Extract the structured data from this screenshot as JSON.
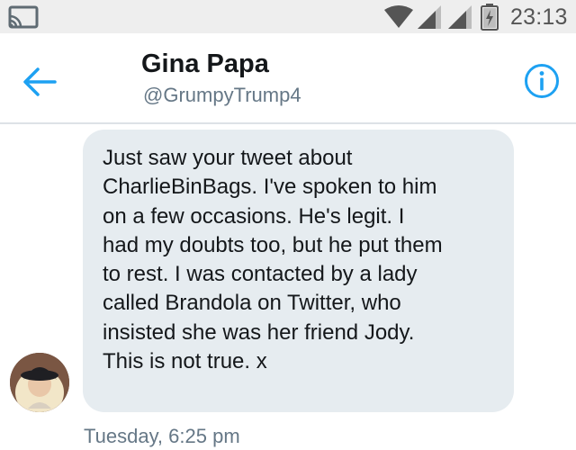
{
  "status_bar": {
    "time": "23:13",
    "icons": [
      "cast-icon",
      "wifi-icon",
      "signal-icon",
      "signal-icon",
      "battery-icon"
    ]
  },
  "header": {
    "display_name": "Gina Papa",
    "handle": "@GrumpyTrump4",
    "back_icon": "arrow-left-icon",
    "info_icon": "info-icon",
    "accent_color": "#1da1f2"
  },
  "conversation": {
    "messages": [
      {
        "text": "Just saw your tweet about\nCharlieBinBags. I've spoken to him\non a few occasions. He's legit. I\nhad my doubts too, but he put them\nto rest. I was contacted by a lady\ncalled Brandola on Twitter, who\ninsisted she was her friend Jody.\nThis is not true. x",
        "timestamp": "Tuesday, 6:25 pm"
      }
    ]
  },
  "colors": {
    "bubble": "#e6ecf0",
    "status_bar": "#eeeeee",
    "secondary_text": "#657786"
  }
}
